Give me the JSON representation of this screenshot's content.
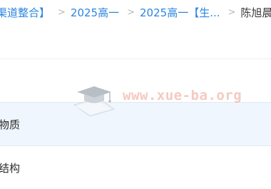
{
  "breadcrumb": {
    "items": [
      "渠道整合】",
      "2025高一",
      "2025高一【生...",
      "陈旭晨"
    ],
    "separator": ">"
  },
  "folder_list": {
    "items": [
      {
        "label": "物质",
        "selected": true
      },
      {
        "label": "结构",
        "selected": false
      }
    ]
  },
  "watermark": {
    "text": "www.xue-ba.org"
  },
  "colors": {
    "link": "#2a85e0",
    "row_highlight": "#f0f6fd",
    "watermark": "#f1b3a6"
  }
}
